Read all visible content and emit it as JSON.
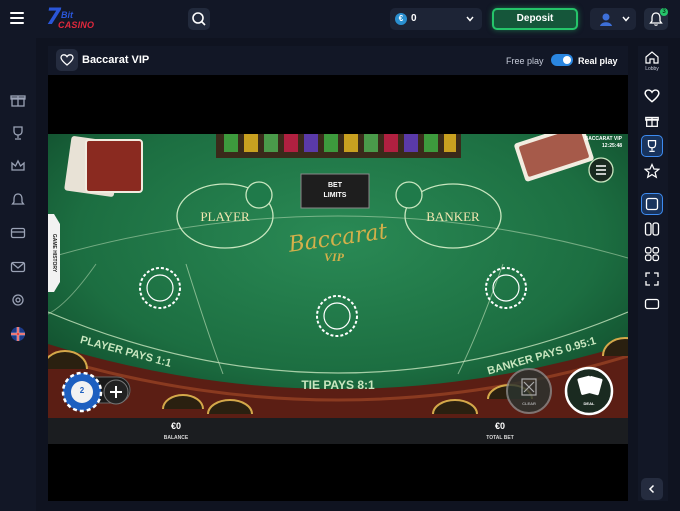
{
  "topbar": {
    "logo_text_1": "7",
    "logo_text_2": "Bit",
    "logo_text_3": "CASINO",
    "balance_currency_icon": "€",
    "balance_value": "0",
    "deposit_label": "Deposit",
    "notifications_count": "3"
  },
  "left_sidebar": {
    "icons": [
      "gift-icon",
      "trophy-icon",
      "crown-icon",
      "bell-icon",
      "card-icon",
      "mail-icon",
      "support-icon",
      "flag-uk-icon"
    ]
  },
  "game_header": {
    "title": "Baccarat VIP",
    "free_play_label": "Free play",
    "real_play_label": "Real play",
    "real_play_enabled": true
  },
  "right_sidebar": {
    "lobby_label": "Lobby",
    "icons": [
      "home-icon",
      "heart-icon",
      "gift-icon",
      "trophy-icon",
      "star-icon",
      "view-single-icon",
      "view-double-icon",
      "view-quad-icon",
      "fullscreen-icon",
      "theater-icon",
      "collapse-icon"
    ]
  },
  "game": {
    "table_title": "BACCARAT VIP",
    "clock": "12:25:48",
    "bet_limits_label_1": "BET",
    "bet_limits_label_2": "LIMITS",
    "player_label": "PLAYER",
    "banker_label": "BANKER",
    "logo_script": "Baccarat",
    "logo_vip": "VIP",
    "player_pays": "PLAYER PAYS 1:1",
    "tie_pays": "TIE PAYS 8:1",
    "banker_pays": "BANKER PAYS 0.95:1",
    "game_history_label": "GAME HISTORY",
    "chip_value": "2",
    "clear_label": "CLEAR",
    "deal_label": "DEAL",
    "balance_value": "€0",
    "balance_label": "BALANCE",
    "total_bet_value": "€0",
    "total_bet_label": "TOTAL BET"
  },
  "colors": {
    "felt": "#1f7a4a",
    "felt_dark": "#0e4d2c",
    "deposit_border": "#25c46a",
    "accent_blue": "#3d8bf0"
  }
}
